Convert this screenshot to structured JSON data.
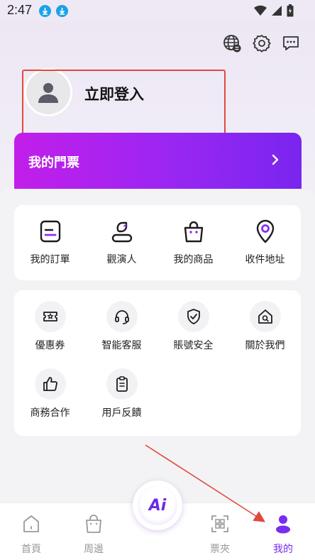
{
  "status_bar": {
    "time": "2:47"
  },
  "profile": {
    "login_label": "立即登入"
  },
  "ticket": {
    "title": "我的門票"
  },
  "quick_actions": [
    {
      "label": "我的訂單",
      "icon": "order-icon"
    },
    {
      "label": "觀演人",
      "icon": "audience-icon"
    },
    {
      "label": "我的商品",
      "icon": "shopping-bag-icon"
    },
    {
      "label": "收件地址",
      "icon": "location-pin-icon"
    }
  ],
  "services": [
    {
      "label": "優惠券",
      "icon": "coupon-icon"
    },
    {
      "label": "智能客服",
      "icon": "headset-icon"
    },
    {
      "label": "賬號安全",
      "icon": "shield-check-icon"
    },
    {
      "label": "關於我們",
      "icon": "home-search-icon"
    },
    {
      "label": "商務合作",
      "icon": "thumbs-up-icon"
    },
    {
      "label": "用戶反饋",
      "icon": "clipboard-icon"
    }
  ],
  "bottom_nav": [
    {
      "label": "首頁",
      "icon": "home-icon",
      "active": false
    },
    {
      "label": "周邊",
      "icon": "bag-icon",
      "active": false
    },
    {
      "label": "票夾",
      "icon": "scan-ticket-icon",
      "active": false
    },
    {
      "label": "我的",
      "icon": "person-icon",
      "active": true
    }
  ],
  "ai_button": {
    "label": "Ai"
  },
  "colors": {
    "accent": "#7a2cf0",
    "banner_start": "#c21ee9",
    "banner_end": "#7a25ef",
    "annotation": "#e04a3c"
  }
}
